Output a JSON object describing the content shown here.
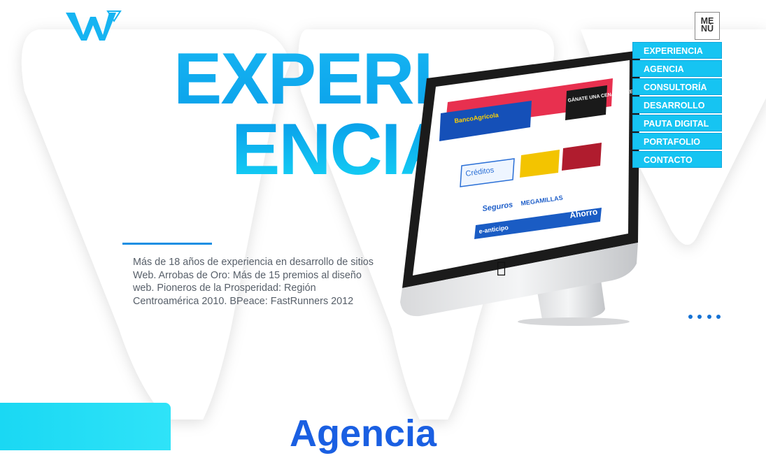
{
  "brand": {
    "accent": "#16b4f2",
    "menu_bg": "#16c4f2",
    "title_blue": "#1a5fe2"
  },
  "hero": {
    "title_line1": "EXPERI",
    "title_line2": "ENCIA",
    "description": "Más de 18 años de experiencia en desarrollo de sitios Web. Arrobas de Oro: Más de 15 premios al diseño web. Pioneros de la Prosperidad: Región Centroamérica 2010. BPeace: FastRunners 2012"
  },
  "menu": {
    "toggle_line1": "ME",
    "toggle_line2": "NÚ",
    "items": [
      {
        "label": "EXPERIENCIA"
      },
      {
        "label": "AGENCIA"
      },
      {
        "label": "CONSULTORÍA"
      },
      {
        "label": "DESARROLLO"
      },
      {
        "label": "PAUTA DIGITAL"
      },
      {
        "label": "PORTAFOLIO"
      },
      {
        "label": "CONTACTO"
      }
    ]
  },
  "screen": {
    "bank_name": "BancoAgrícola",
    "promo": "GÁNATE UNA CENA DOBLE",
    "creditos": "Créditos",
    "seguros": "Seguros",
    "megamillas": "MEGAMILLAS",
    "ahorro": "Ahorro",
    "anticipo": "e-anticipo"
  },
  "slider": {
    "dot_count": 4
  },
  "next_section": {
    "title": "Agencia"
  }
}
